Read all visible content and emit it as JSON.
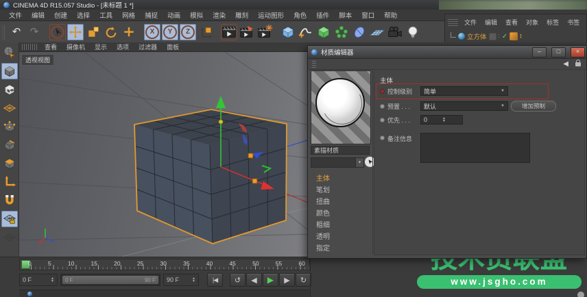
{
  "window": {
    "title": "CINEMA 4D R15.057 Studio - [未标题 1 *]"
  },
  "menubar": {
    "items": [
      "文件",
      "编辑",
      "创建",
      "选择",
      "工具",
      "网格",
      "捕捉",
      "动画",
      "模拟",
      "渲染",
      "雕刻",
      "运动图形",
      "角色",
      "插件",
      "脚本",
      "窗口",
      "帮助"
    ]
  },
  "toolbar": {
    "undo_glyph": "↶",
    "redo_glyph": "↷",
    "xyz": [
      "X",
      "Y",
      "Z"
    ]
  },
  "object_manager": {
    "menu": [
      "文件",
      "编辑",
      "查看",
      "对象",
      "标签",
      "书签"
    ],
    "object_label": "立方体",
    "check_glyph": "✓",
    "dots_glyph": "∶"
  },
  "viewport": {
    "menu": [
      "查看",
      "摄像机",
      "显示",
      "选项",
      "过滤器",
      "面板"
    ],
    "view_label": "透视视图"
  },
  "material_editor": {
    "title": "材质编辑器",
    "controls": {
      "minimize": "–",
      "maximize": "□",
      "close": "×"
    },
    "back_glyph": "◀",
    "preview_label": "素描材质",
    "combo_button_glyph": "▾",
    "nav": [
      "主体",
      "笔划",
      "扭曲",
      "颜色",
      "粗细",
      "透明",
      "指定"
    ],
    "section": "主体",
    "fields": {
      "control_label": "控制级别",
      "control_value": "简单",
      "preset_label": "预置 . . .",
      "preset_value": "默认",
      "priority_label": "优先 . . .",
      "priority_value": "0",
      "notes_label": "备注信息"
    },
    "add_preset_button": "增加预制",
    "highlight_color": "#a33226",
    "dropdown_glyph": "▼"
  },
  "timeline": {
    "ruler": [
      "0",
      "5",
      "10",
      "15",
      "20",
      "25",
      "30",
      "35",
      "40",
      "45",
      "50",
      "55",
      "60"
    ],
    "current_frame": "0 F",
    "range_start": "0 F",
    "range_end": "90 F",
    "end_frame": "90 F",
    "buttons": {
      "goto_start": "|◀",
      "play_backward": "↺",
      "prev_frame": "◀",
      "play": "▶",
      "next_frame": "▶",
      "loop": "↻"
    }
  },
  "watermark": {
    "title": "技术员联盟",
    "url": "www.jsgho.com",
    "color": "#3bbf71"
  }
}
